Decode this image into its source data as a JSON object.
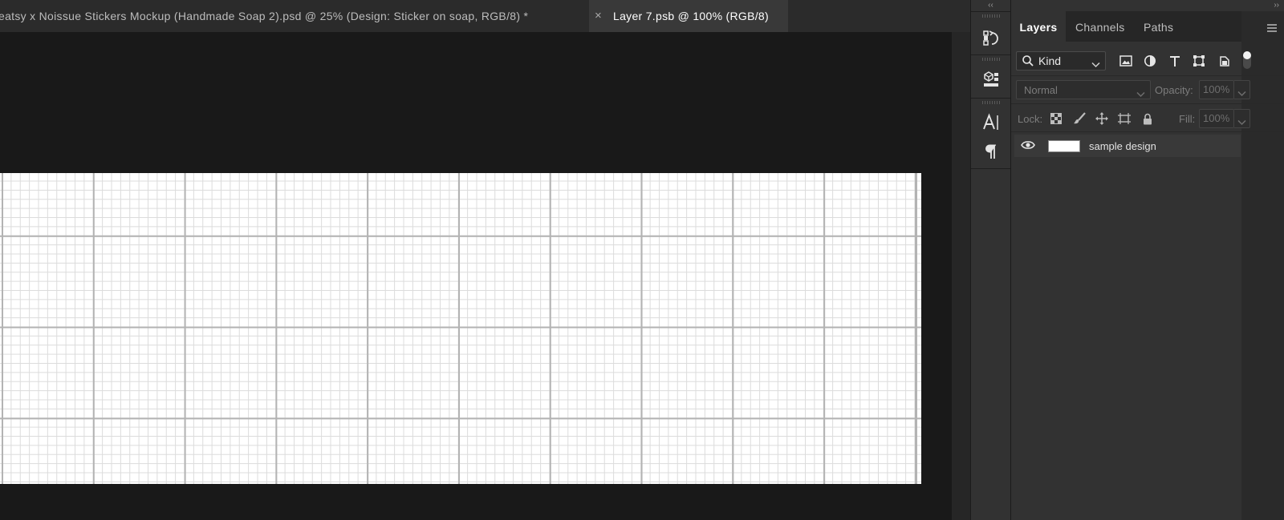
{
  "document_tabs": [
    {
      "label": "eatsy x Noissue Stickers Mockup (Handmade Soap 2).psd @ 25% (Design: Sticker on soap, RGB/8) *",
      "active": false
    },
    {
      "label": "Layer 7.psb @ 100% (RGB/8)",
      "active": true,
      "close_glyph": "×"
    }
  ],
  "icon_strip": {
    "collapse_glyph": "‹‹",
    "buttons": [
      "history-icon",
      "properties-icon",
      "character-icon",
      "paragraph-icon"
    ]
  },
  "panel": {
    "collapse_glyph": "››",
    "tabs": [
      "Layers",
      "Channels",
      "Paths"
    ],
    "active_tab": "Layers",
    "filter": {
      "kind_label": "Kind",
      "icons": [
        "pixel-filter-icon",
        "adjustment-filter-icon",
        "type-filter-icon",
        "shape-filter-icon",
        "smart-object-filter-icon"
      ]
    },
    "blend_mode": "Normal",
    "opacity_label": "Opacity:",
    "opacity_value": "100%",
    "lock_label": "Lock:",
    "fill_label": "Fill:",
    "fill_value": "100%",
    "layers": [
      {
        "name": "sample design",
        "visible": true
      }
    ]
  },
  "colors": {
    "app_bg": "#1e1e1e",
    "panel_bg": "#323232",
    "canvas": "#ffffff",
    "grid_major": "#b3b3b3",
    "grid_minor": "#dcdcdc"
  }
}
